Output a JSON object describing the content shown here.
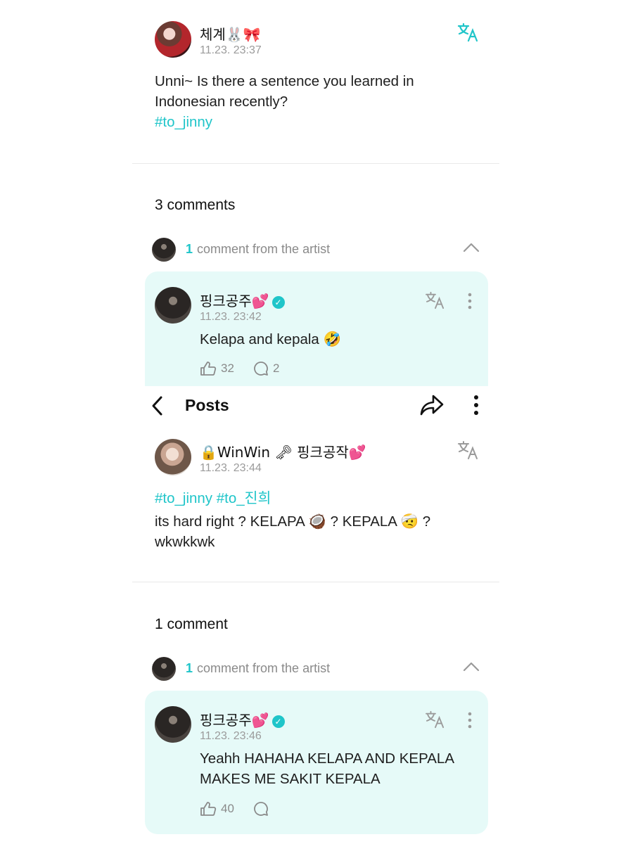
{
  "post1": {
    "author": "체계🐰🎀",
    "time": "11.23. 23:37",
    "text_line1": "Unni~ Is there a sentence you learned in",
    "text_line2": "Indonesian recently?",
    "hashtag": "#to_jinny",
    "comments_count": "3 comments",
    "artist_count": "1",
    "artist_label": "comment from the artist",
    "comment": {
      "author": "핑크공주💕",
      "time": "11.23. 23:42",
      "text": "Kelapa and kepala 🤣",
      "likes": "32",
      "replies": "2"
    }
  },
  "navbar": {
    "title": "Posts"
  },
  "post2": {
    "author": "🔒WinWin 🗝 핑크공작💕",
    "time": "11.23. 23:44",
    "hashtags": "#to_jinny #to_진희",
    "text_line1": "its hard right ? KELAPA 🥥 ? KEPALA 🤕 ?",
    "text_line2": "wkwkkwk",
    "comments_count": "1 comment",
    "artist_count": "1",
    "artist_label": "comment from the artist",
    "comment": {
      "author": "핑크공주💕",
      "time": "11.23. 23:46",
      "text_line1": "Yeahh HAHAHA KELAPA AND KEPALA",
      "text_line2": "MAKES ME SAKIT KEPALA",
      "likes": "40"
    }
  },
  "colors": {
    "accent": "#1fc5c9",
    "card_bg": "#e6faf8"
  },
  "icons": [
    "translate-icon",
    "chevron-up-icon",
    "more-vert-icon",
    "like-icon",
    "reply-icon",
    "back-icon",
    "share-icon",
    "verified-icon"
  ]
}
